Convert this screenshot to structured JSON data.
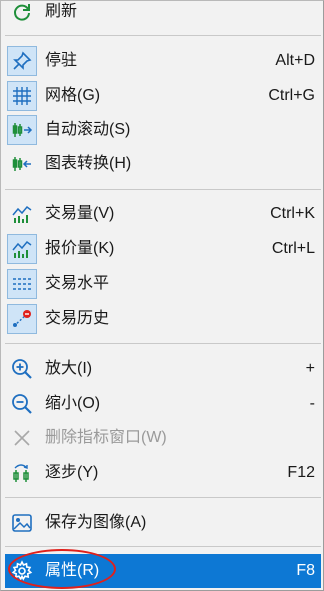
{
  "colors": {
    "menu_bg": "#f2f2f2",
    "selected_bg": "#0d78d4",
    "check_bg": "#cfe4f7",
    "icon_green": "#1f8f3a",
    "icon_blue": "#1f6fc0",
    "annotation_red": "#e0201b"
  },
  "menu": {
    "refresh": {
      "label": "刷新",
      "icon": "refresh-icon"
    },
    "pin": {
      "label": "停驻",
      "shortcut": "Alt+D",
      "icon": "pin-icon",
      "checked": true
    },
    "grid": {
      "label": "网格(G)",
      "shortcut": "Ctrl+G",
      "icon": "grid-icon",
      "checked": true
    },
    "autoscroll": {
      "label": "自动滚动(S)",
      "icon": "autoscroll-icon",
      "checked": true
    },
    "chartshift": {
      "label": "图表转换(H)",
      "icon": "chart-shift-icon"
    },
    "volume": {
      "label": "交易量(V)",
      "shortcut": "Ctrl+K",
      "icon": "volume-icon"
    },
    "tickvolume": {
      "label": "报价量(K)",
      "shortcut": "Ctrl+L",
      "icon": "tick-volume-icon",
      "checked": true
    },
    "tradelevels": {
      "label": "交易水平",
      "icon": "trade-levels-icon",
      "checked": true
    },
    "tradehistory": {
      "label": "交易历史",
      "icon": "trade-history-icon",
      "checked": true
    },
    "zoomin": {
      "label": "放大(I)",
      "shortcut": "+",
      "icon": "zoom-in-icon"
    },
    "zoomout": {
      "label": "缩小(O)",
      "shortcut": "-",
      "icon": "zoom-out-icon"
    },
    "delete_indicator": {
      "label": "删除指标窗口(W)",
      "icon": "close-icon",
      "disabled": true
    },
    "step": {
      "label": "逐步(Y)",
      "shortcut": "F12",
      "icon": "step-icon"
    },
    "saveimage": {
      "label": "保存为图像(A)",
      "icon": "image-icon"
    },
    "properties": {
      "label": "属性(R)",
      "shortcut": "F8",
      "icon": "gear-icon",
      "selected": true
    }
  }
}
